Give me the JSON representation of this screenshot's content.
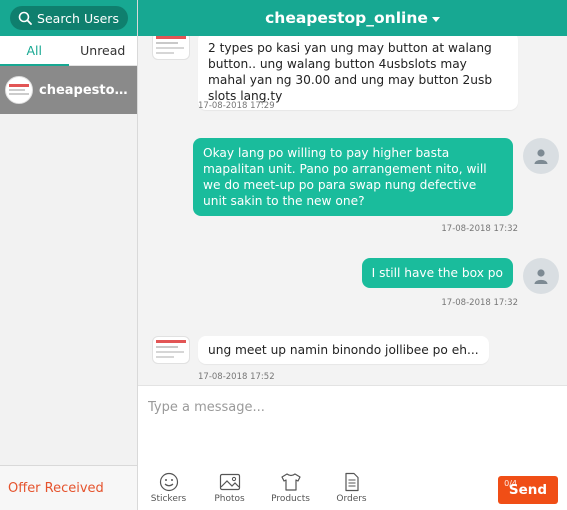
{
  "left_panel": {
    "search_label": "Search Users",
    "tabs": [
      {
        "label": "All",
        "active": true
      },
      {
        "label": "Unread",
        "active": false
      }
    ],
    "conversations": [
      {
        "name": "cheapestop_..."
      }
    ],
    "offer_received_label": "Offer Received"
  },
  "chat": {
    "title": "cheapestop_online",
    "messages": [
      {
        "direction": "in",
        "text": "2 types po kasi yan ung may button at walang button.. ung walang button 4usbslots may mahal yan ng 30.00 and ung may button 2usb slots lang.ty",
        "time": "17-08-2018 17:29"
      },
      {
        "direction": "out",
        "text": "Okay lang po willing to pay higher basta mapalitan unit. Pano po arrangement nito, will we do meet-up po para swap nung defective unit sakin to the new one?",
        "time": "17-08-2018 17:32"
      },
      {
        "direction": "out",
        "text": "I still have the box po",
        "time": "17-08-2018 17:32"
      },
      {
        "direction": "in",
        "text": "ung meet up namin binondo jollibee po eh...",
        "time": "17-08-2018 17:52"
      }
    ]
  },
  "composer": {
    "placeholder": "Type a message...",
    "tools": [
      {
        "label": "Stickers",
        "icon": "smiley-icon"
      },
      {
        "label": "Photos",
        "icon": "image-icon"
      },
      {
        "label": "Products",
        "icon": "shirt-icon"
      },
      {
        "label": "Orders",
        "icon": "document-icon"
      }
    ],
    "char_count": "0/4",
    "send_label": "Send"
  },
  "colors": {
    "brand_teal": "#17a892",
    "outgoing_bubble": "#1abc9c",
    "send_button": "#f04e16",
    "offer_text": "#e5532d"
  }
}
